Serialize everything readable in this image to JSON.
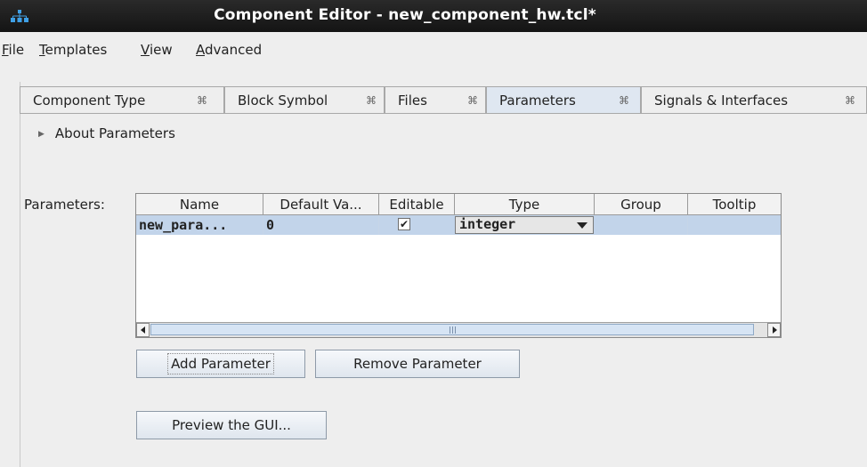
{
  "window": {
    "title": "Component Editor - new_component_hw.tcl*",
    "app_icon": "network-icon"
  },
  "menu": [
    {
      "label": "File",
      "mnemonic": "F",
      "rest": "ile"
    },
    {
      "label": "Templates",
      "mnemonic": "T",
      "rest": "emplates"
    },
    {
      "label": "View",
      "mnemonic": "V",
      "rest": "iew"
    },
    {
      "label": "Advanced",
      "mnemonic": "A",
      "rest": "dvanced"
    }
  ],
  "tabs": [
    {
      "label": "Component Type",
      "close": "⌘"
    },
    {
      "label": "Block Symbol",
      "close": "⌘"
    },
    {
      "label": "Files",
      "close": "⌘"
    },
    {
      "label": "Parameters",
      "close": "⌘",
      "active": true
    },
    {
      "label": "Signals & Interfaces",
      "close": "⌘"
    }
  ],
  "about": {
    "label": "About Parameters"
  },
  "params": {
    "label": "Parameters:",
    "columns": [
      "Name",
      "Default Va...",
      "Editable",
      "Type",
      "Group",
      "Tooltip"
    ],
    "rows": [
      {
        "name": "new_para...",
        "default": "0",
        "editable_mark": "✔",
        "type": "integer",
        "group": "",
        "tooltip": ""
      }
    ],
    "scroll_grip": "|||"
  },
  "buttons": {
    "add": "Add Parameter",
    "remove": "Remove Parameter",
    "preview": "Preview the GUI..."
  },
  "colors": {
    "titlebar": "#1c1c1c",
    "selected_row": "#c2d4ea",
    "active_tab": "#dfe7f1"
  }
}
